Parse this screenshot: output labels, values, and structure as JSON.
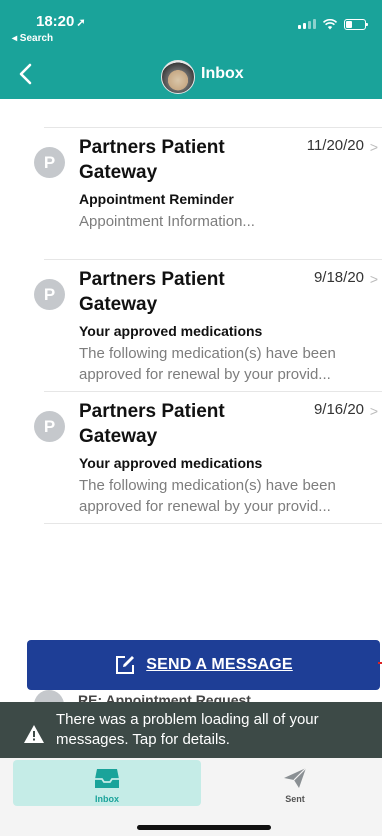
{
  "status_bar": {
    "time": "18:20",
    "back_label": "◂ Search"
  },
  "header": {
    "title": "Inbox"
  },
  "messages": [
    {
      "initial": "P",
      "sender": "Partners Patient Gateway",
      "date": "11/20/20",
      "subject": "Appointment Reminder",
      "preview": "Appointment Information..."
    },
    {
      "initial": "P",
      "sender": "Partners Patient Gateway",
      "date": "9/18/20",
      "subject": "Your approved medications",
      "preview": "The following medication(s) have been approved for renewal by your provid..."
    },
    {
      "initial": "P",
      "sender": "Partners Patient Gateway",
      "date": "9/16/20",
      "subject": "Your approved medications",
      "preview": "The following medication(s) have been approved for renewal by your provid..."
    }
  ],
  "peek_subject": "RE: Appointment Request",
  "send_button": {
    "label": "SEND A MESSAGE"
  },
  "banner": {
    "text": "There was a problem loading all of your messages. Tap for details."
  },
  "tabs": {
    "inbox": "Inbox",
    "sent": "Sent"
  },
  "colors": {
    "header": "#1aa39a",
    "button": "#1e3e96",
    "banner": "#3d4a47",
    "tab_active": "#c5ece7"
  }
}
